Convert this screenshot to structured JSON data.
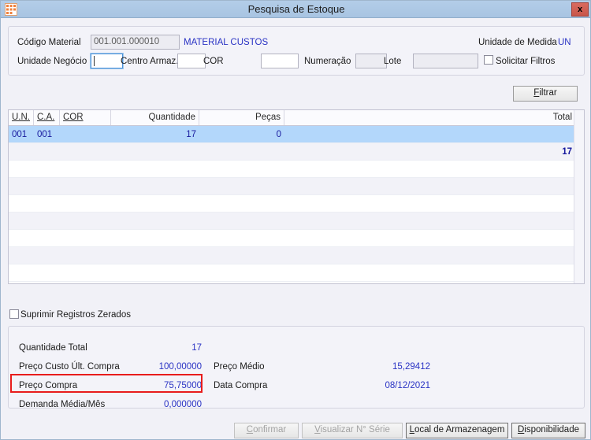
{
  "window": {
    "title": "Pesquisa de Estoque",
    "icon": "app-grid-icon",
    "close_label": "x",
    "accent_title_bg": "#a8c4e2",
    "accent_close_bg": "#c8564a",
    "highlight_color": "#e81c1c"
  },
  "filters": {
    "codigo_material_label": "Código Material",
    "codigo_material_value": "001.001.000010",
    "material_description": "MATERIAL CUSTOS",
    "unidade_medida_label": "Unidade de Medida",
    "unidade_medida_value": "UN",
    "unidade_negocio_label": "Unidade Negócio",
    "unidade_negocio_value": "",
    "centro_armaz_label": "Centro Armaz.",
    "centro_armaz_value": "",
    "cor_label": "COR",
    "cor_value": "",
    "numeracao_label": "Numeração",
    "numeracao_value": "",
    "lote_label": "Lote",
    "lote_value": "",
    "solicitar_filtros_label": "Solicitar Filtros",
    "solicitar_filtros_checked": false,
    "filtrar_button": {
      "prefix": "",
      "accel": "F",
      "suffix": "iltrar"
    }
  },
  "grid": {
    "columns": [
      {
        "label": "U.N.",
        "underline": true,
        "align": "left"
      },
      {
        "label": "C.A.",
        "underline": true,
        "align": "left"
      },
      {
        "label": "COR",
        "underline": true,
        "align": "left"
      },
      {
        "label": "Quantidade",
        "underline": false,
        "align": "right"
      },
      {
        "label": "Peças",
        "underline": false,
        "align": "right"
      },
      {
        "label": "Total",
        "underline": false,
        "align": "right"
      }
    ],
    "rows": [
      {
        "selected": true,
        "un": "001",
        "ca": "001",
        "cor": "",
        "quantidade": "17",
        "pecas": "0",
        "total": ""
      },
      {
        "selected": false,
        "un": "",
        "ca": "",
        "cor": "",
        "quantidade": "",
        "pecas": "",
        "total": "17",
        "total_bold": true
      }
    ],
    "empty_row_count": 7
  },
  "options": {
    "suprimir_label": "Suprimir Registros Zerados",
    "suprimir_checked": false
  },
  "summary": {
    "quantidade_total_label": "Quantidade Total",
    "quantidade_total_value": "17",
    "preco_custo_label": "Preço Custo Últ. Compra",
    "preco_custo_value": "100,00000",
    "preco_compra_label": "Preço Compra",
    "preco_compra_value": "75,75000",
    "demanda_label": "Demanda Média/Mês",
    "demanda_value": "0,000000",
    "preco_medio_label": "Preço Médio",
    "preco_medio_value": "15,29412",
    "data_compra_label": "Data Compra",
    "data_compra_value": "08/12/2021"
  },
  "buttons": {
    "confirmar": {
      "prefix": "",
      "accel": "C",
      "suffix": "onfirmar",
      "disabled": true
    },
    "visualizar": {
      "prefix": "",
      "accel": "V",
      "suffix": "isualizar N° Série",
      "disabled": true
    },
    "local_armazenagem": {
      "prefix": "",
      "accel": "L",
      "suffix": "ocal de Armazenagem",
      "disabled": false
    },
    "disponibilidade": {
      "prefix": "",
      "accel": "D",
      "suffix": "isponibilidade",
      "disabled": false
    }
  }
}
